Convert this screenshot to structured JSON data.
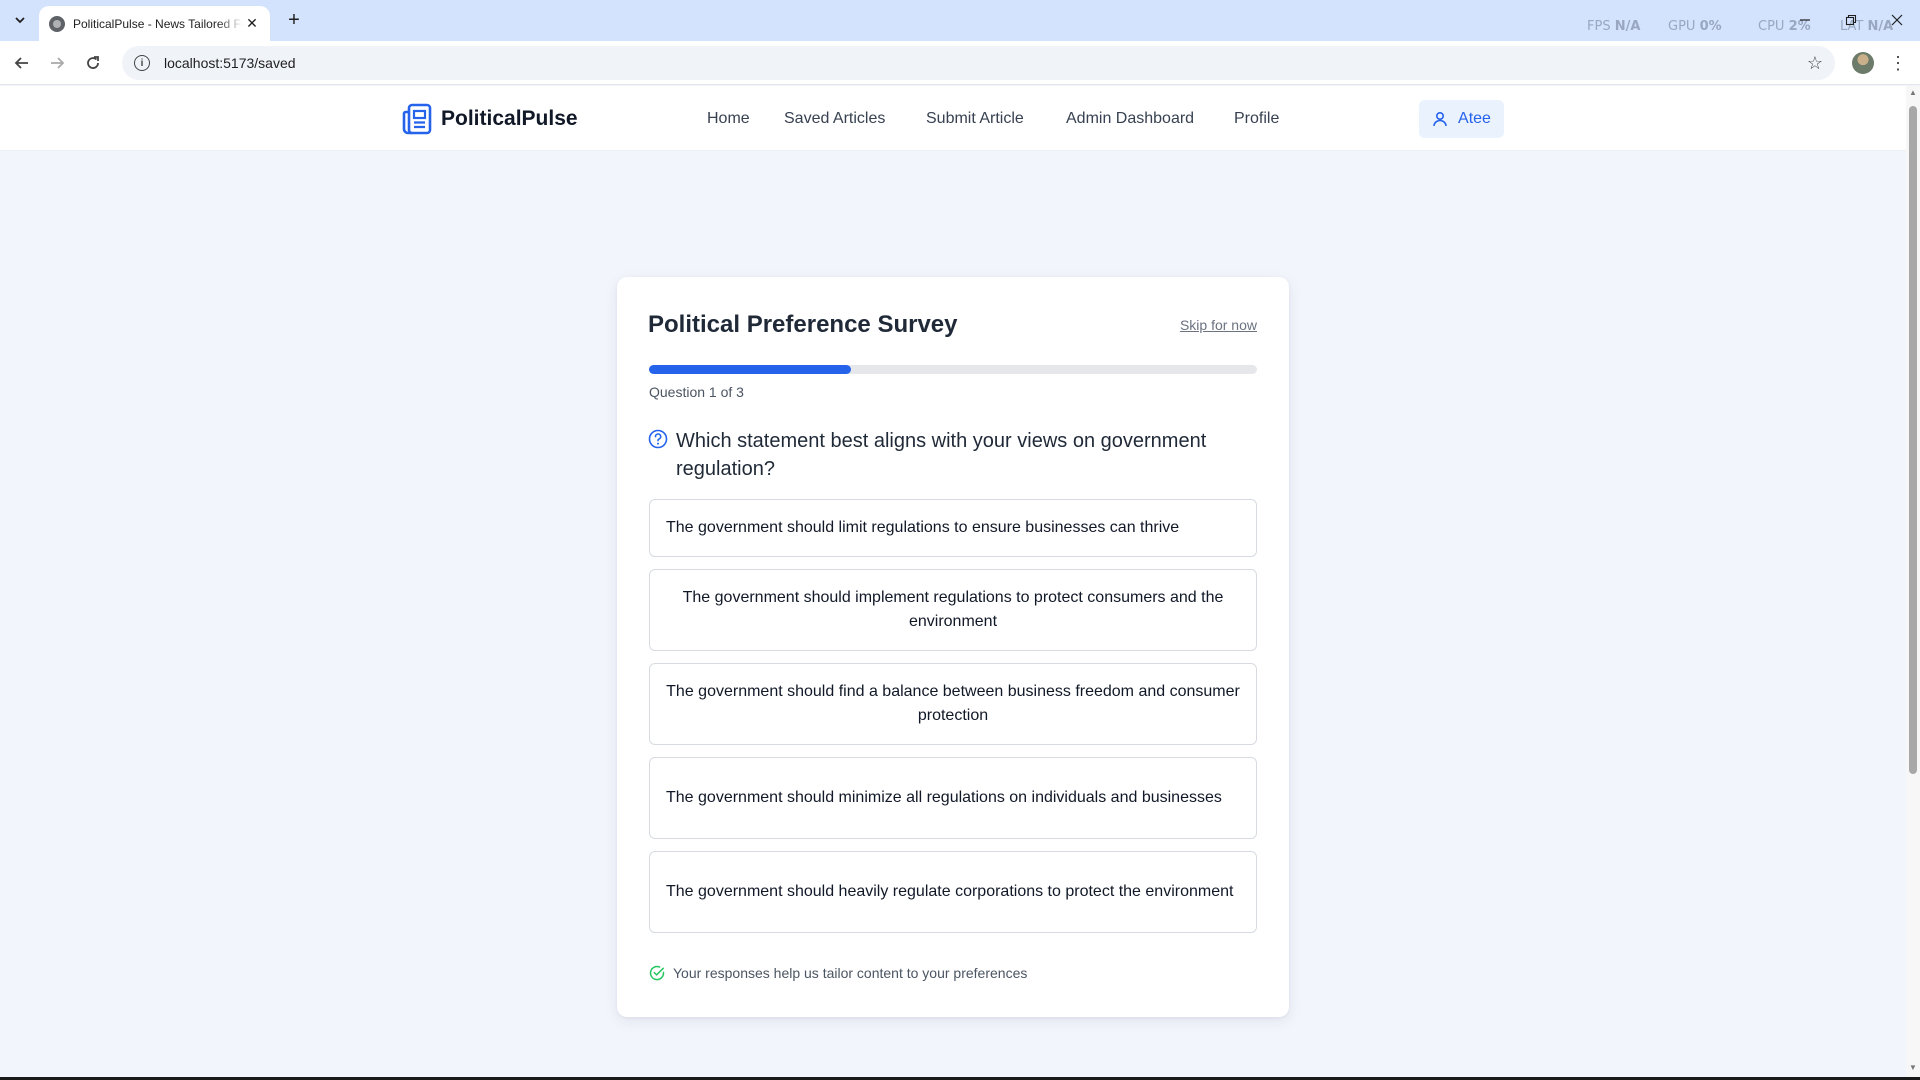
{
  "browser": {
    "tab_title": "PoliticalPulse - News Tailored For You",
    "tab_close": "✕",
    "new_tab": "+",
    "url": "localhost:5173/saved",
    "perf": {
      "fps_label": "FPS",
      "fps_value": "N/A",
      "gpu_label": "GPU",
      "gpu_value": "0%",
      "cpu_label": "CPU",
      "cpu_value": "2%",
      "lat_label": "LAT",
      "lat_value": "N/A"
    }
  },
  "header": {
    "brand": "PoliticalPulse",
    "nav": [
      "Home",
      "Saved Articles",
      "Submit Article",
      "Admin Dashboard",
      "Profile"
    ],
    "user_name": "Atee"
  },
  "survey": {
    "title": "Political Preference Survey",
    "skip_label": "Skip for now",
    "progress_fraction": 0.333,
    "progress_text": "Question 1 of 3",
    "question": "Which statement best aligns with your views on government regulation?",
    "options": [
      "The government should limit regulations to ensure businesses can thrive",
      "The government should implement regulations to protect consumers and the environment",
      "The government should find a balance between business freedom and consumer protection",
      "The government should minimize all regulations on individuals and businesses",
      "The government should heavily regulate corporations to protect the environment"
    ],
    "footnote": "Your responses help us tailor content to your preferences"
  },
  "colors": {
    "accent": "#2563eb",
    "success": "#22c55e",
    "page_bg": "#f3f5fc"
  }
}
